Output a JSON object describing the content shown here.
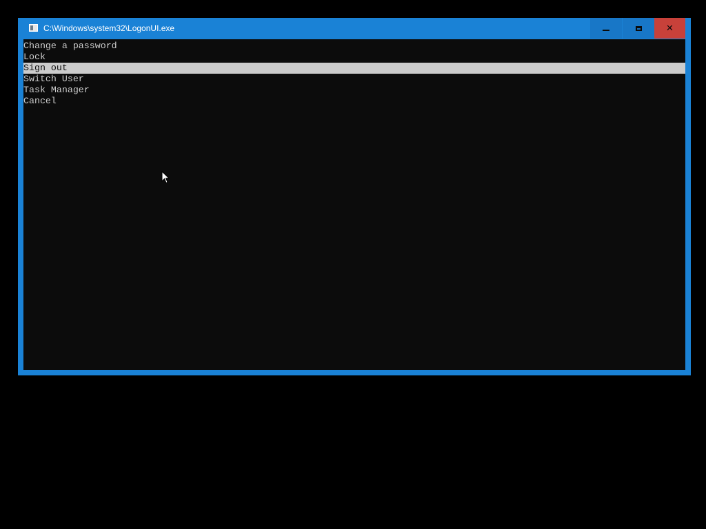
{
  "window": {
    "title": "C:\\Windows\\system32\\LogonUI.exe",
    "controls": {
      "minimize_icon": "minimize-icon",
      "maximize_icon": "maximize-icon",
      "close_icon": "close-icon"
    },
    "accent_color": "#1a82d6",
    "close_color": "#c8413a"
  },
  "console": {
    "background": "#0c0c0c",
    "text_color": "#cccccc",
    "menu": [
      {
        "label": "Change a password",
        "selected": false
      },
      {
        "label": "Lock",
        "selected": false
      },
      {
        "label": "Sign out",
        "selected": true
      },
      {
        "label": "Switch User",
        "selected": false
      },
      {
        "label": "Task Manager",
        "selected": false
      },
      {
        "label": "Cancel",
        "selected": false
      }
    ]
  }
}
